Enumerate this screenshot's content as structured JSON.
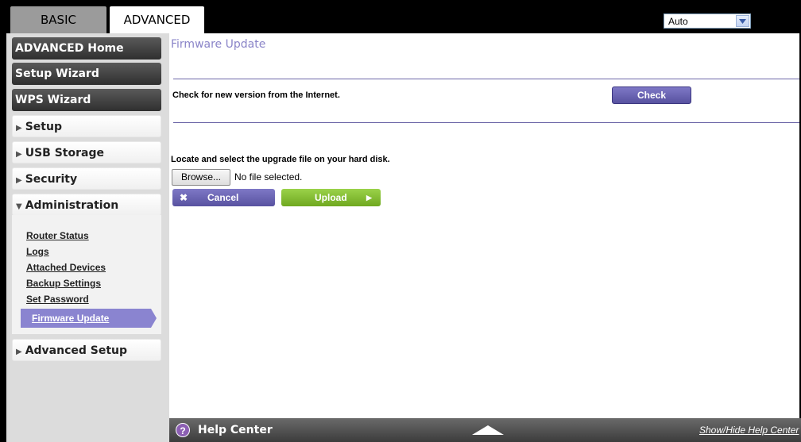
{
  "tabs": [
    {
      "label": "BASIC"
    },
    {
      "label": "ADVANCED"
    }
  ],
  "language_select": {
    "value": "Auto"
  },
  "sidebar": {
    "primary": [
      {
        "label": "ADVANCED Home"
      },
      {
        "label": "Setup Wizard"
      },
      {
        "label": "WPS Wizard"
      }
    ],
    "sections": [
      {
        "label": "Setup"
      },
      {
        "label": "USB Storage"
      },
      {
        "label": "Security"
      },
      {
        "label": "Administration"
      },
      {
        "label": "Advanced Setup"
      }
    ],
    "admin_items": [
      {
        "label": "Router Status"
      },
      {
        "label": "Logs"
      },
      {
        "label": "Attached Devices"
      },
      {
        "label": "Backup Settings"
      },
      {
        "label": "Set Password"
      },
      {
        "label": "Firmware Update"
      }
    ]
  },
  "main": {
    "title": "Firmware Update",
    "check_text": "Check for new version from the Internet.",
    "check_button": "Check",
    "locate_text": "Locate and select the upgrade file on your hard disk.",
    "browse_button": "Browse...",
    "no_file": "No file selected.",
    "cancel_button": "Cancel",
    "upload_button": "Upload"
  },
  "help": {
    "label": "Help Center",
    "toggle": "Show/Hide Help Center"
  },
  "colors": {
    "accent_purple": "#6c66a8",
    "upload_green": "#7fbf2a",
    "title_purple": "#8a84c8"
  }
}
